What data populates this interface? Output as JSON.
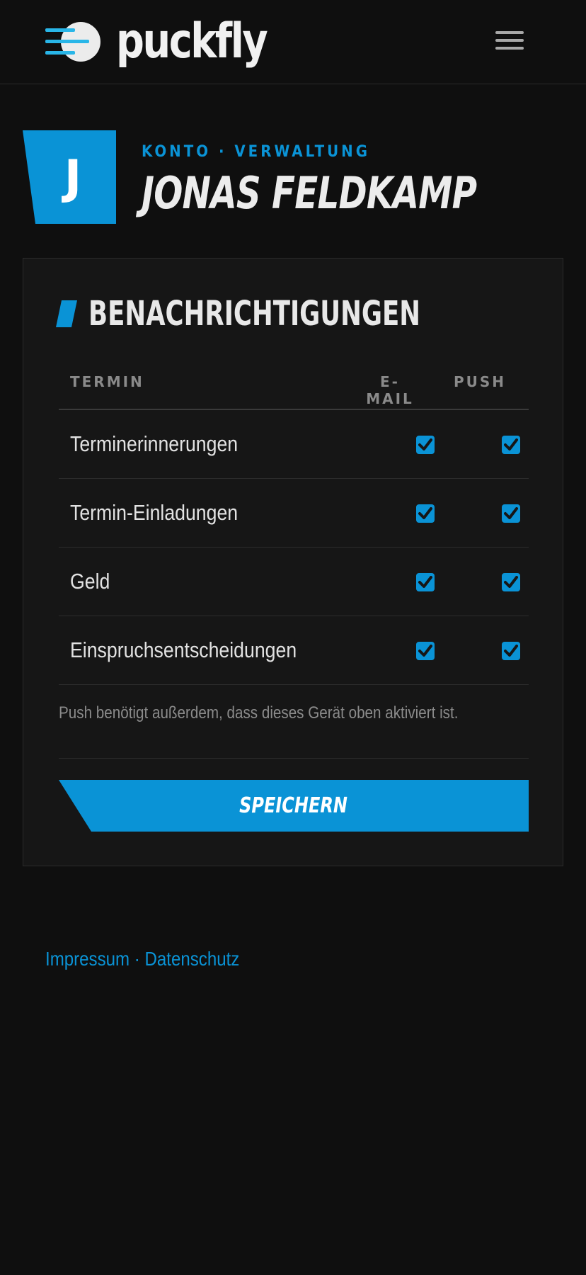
{
  "brand": {
    "name": "puckfly",
    "accent": "#0a93d6",
    "logo_icon": "speeding-puck-icon"
  },
  "header": {
    "menu_icon": "hamburger-menu-icon"
  },
  "profile": {
    "avatar_letter": "J",
    "eyebrow": "KONTO · VERWALTUNG",
    "name": "JONAS FELDKAMP"
  },
  "notifications": {
    "title": "BENACHRICHTIGUNGEN",
    "columns": [
      "TERMIN",
      "E-MAIL",
      "PUSH"
    ],
    "rows": [
      {
        "label": "Terminerinnerungen",
        "email": true,
        "push": true
      },
      {
        "label": "Termin-Einladungen",
        "email": true,
        "push": true
      },
      {
        "label": "Geld",
        "email": true,
        "push": true
      },
      {
        "label": "Einspruchsentscheidungen",
        "email": true,
        "push": true
      }
    ],
    "note": "Push benötigt außerdem, dass dieses Gerät oben aktiviert ist.",
    "save_label": "SPEICHERN"
  },
  "footer": {
    "impressum": "Impressum",
    "separator": " · ",
    "datenschutz": "Datenschutz"
  }
}
